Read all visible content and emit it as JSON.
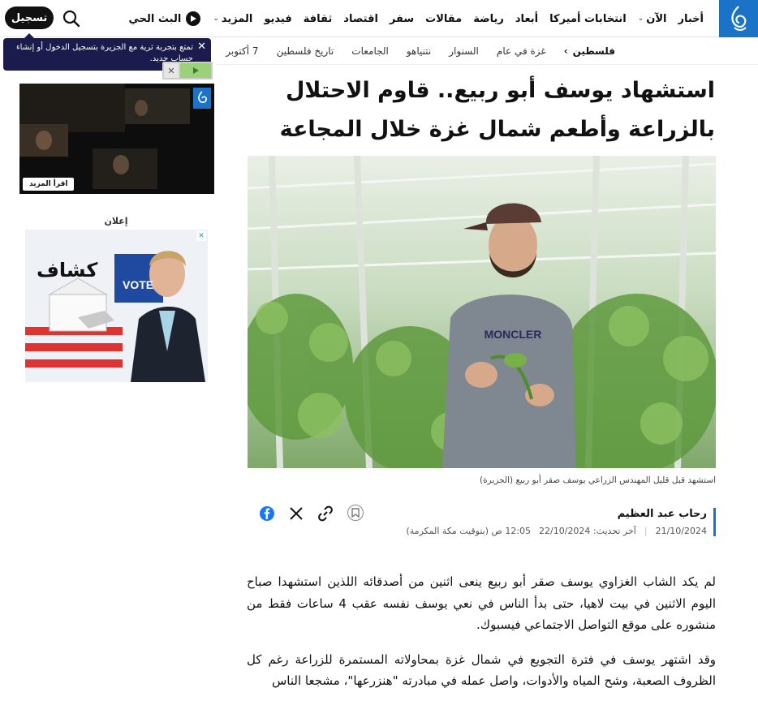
{
  "nav": {
    "items": [
      {
        "label": "أخبار",
        "chevron": false
      },
      {
        "label": "الآن",
        "chevron": true
      },
      {
        "label": "انتخابات أميركا",
        "chevron": false
      },
      {
        "label": "أبعاد",
        "chevron": false
      },
      {
        "label": "رياضة",
        "chevron": false
      },
      {
        "label": "مقالات",
        "chevron": false
      },
      {
        "label": "سفر",
        "chevron": false
      },
      {
        "label": "اقتصاد",
        "chevron": false
      },
      {
        "label": "ثقافة",
        "chevron": false
      },
      {
        "label": "فيديو",
        "chevron": false
      },
      {
        "label": "المزيد",
        "chevron": true
      }
    ],
    "live_label": "البث الحي",
    "register_label": "تسجيل"
  },
  "tooltip": {
    "text": "تمتع بتجربة ثرية مع الجزيرة بتسجيل الدخول أو إنشاء حساب جديد."
  },
  "breadcrumb": {
    "section": "فلسطين",
    "tags": [
      "غزة في عام",
      "السنوار",
      "نتنياهو",
      "الجامعات",
      "تاريخ فلسطين",
      "7 أكتوبر"
    ]
  },
  "article": {
    "title": "استشهاد يوسف أبو ربيع.. قاوم الاحتلال بالزراعة وأطعم شمال غزة خلال المجاعة",
    "caption": "استشهد قبل قليل المهندس الزراعي يوسف صقر أبو ربيع (الجزيرة)",
    "author": "رحاب عبد العظيم",
    "published": "21/10/2024",
    "updated": "آخر تحديث: 22/10/2024",
    "time": "12:05 ص (بتوقيت مكة المكرمة)",
    "paragraphs": [
      "لم يكد الشاب الغزاوي يوسف صقر أبو ربيع ينعى اثنين من أصدقائه اللذين استشهدا صباح اليوم الاثنين في بيت لاهيا، حتى بدأ الناس في نعي يوسف نفسه عقب 4 ساعات فقط من منشوره على موقع التواصل الاجتماعي فيسبوك.",
      "وقد اشتهر يوسف في فترة التجويع في شمال غزة بمحاولاته المستمرة للزراعة رغم كل الظروف الصعبة، وشح المياه والأدوات، واصل عمله في مبادرته \"هنزرعها\"، مشجعا الناس"
    ]
  },
  "sidebar": {
    "video_more_label": "اقرأ المزيد",
    "ad_label": "إعلان",
    "ad_title": "كشاف",
    "ad_vote": "VOTE"
  },
  "colors": {
    "brand": "#1a73c7",
    "tooltip_bg": "#1b1b4d"
  }
}
